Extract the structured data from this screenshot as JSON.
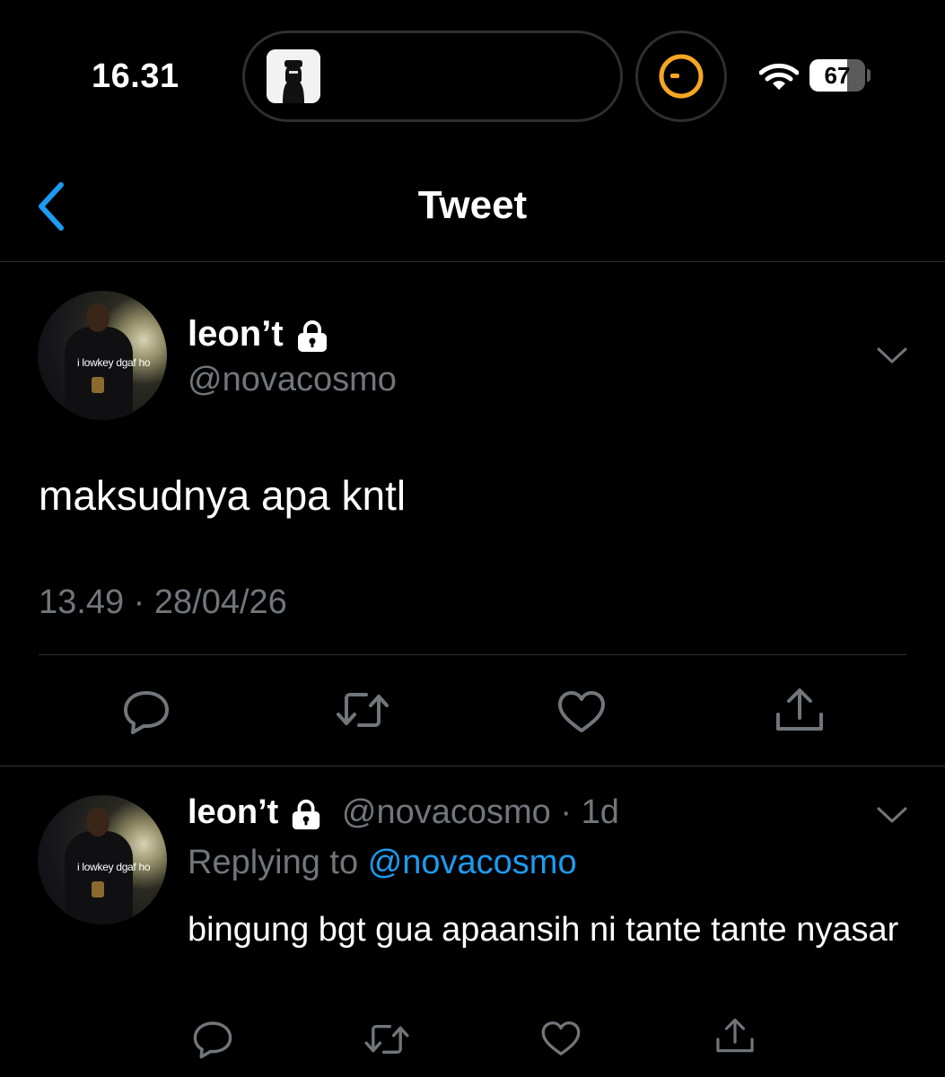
{
  "status_bar": {
    "time": "16.31",
    "battery_level": "67",
    "battery_fraction": 0.67
  },
  "header": {
    "title": "Tweet"
  },
  "main_tweet": {
    "display_name": "leon’t",
    "handle": "@novacosmo",
    "avatar_caption": "i lowkey dgaf ho",
    "text": "maksudnya apa kntl",
    "timestamp": "13.49 · 28/04/26",
    "actions": [
      "reply-icon",
      "retweet-icon",
      "like-icon",
      "share-icon"
    ]
  },
  "reply_tweet": {
    "display_name": "leon’t",
    "handle": "@novacosmo",
    "meta": "· 1d",
    "avatar_caption": "i lowkey dgaf ho",
    "replying_to_prefix": "Replying to",
    "replying_to_handle": "@novacosmo",
    "text": "bingung bgt gua apaansih ni tante tante nyasar",
    "actions": [
      "reply-icon",
      "retweet-icon",
      "like-icon",
      "share-icon"
    ]
  },
  "colors": {
    "background": "#000000",
    "secondary_text": "#71767b",
    "accent": "#1d9bf0",
    "divider": "#2f3336",
    "timer_ring": "#f5a623"
  }
}
